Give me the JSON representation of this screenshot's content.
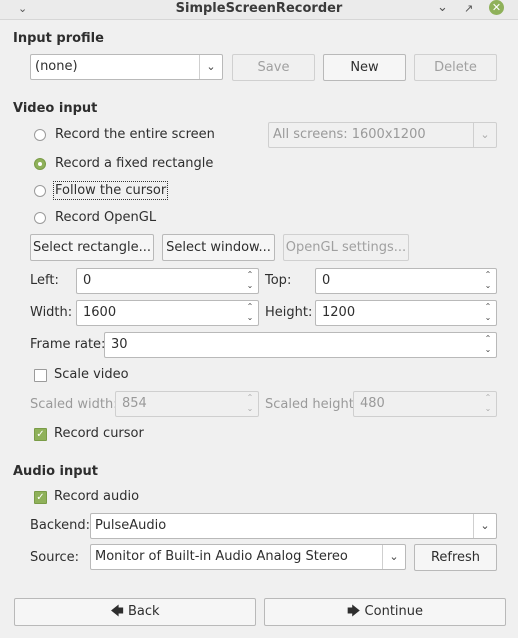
{
  "window": {
    "title": "SimpleScreenRecorder"
  },
  "icons": {
    "minimize": "chevron-down-icon",
    "restore": "restore-icon",
    "close": "close-icon"
  },
  "input_profile": {
    "heading": "Input profile",
    "selected": "(none)",
    "save_label": "Save",
    "new_label": "New",
    "delete_label": "Delete"
  },
  "video_input": {
    "heading": "Video input",
    "radio_entire_screen": "Record the entire screen",
    "radio_fixed_rect": "Record a fixed rectangle",
    "radio_follow_cursor": "Follow the cursor",
    "radio_opengl": "Record OpenGL",
    "selected_mode": "Record a fixed rectangle",
    "screen_select": "All screens: 1600x1200",
    "select_rectangle": "Select rectangle...",
    "select_window": "Select window...",
    "opengl_settings": "OpenGL settings...",
    "left_label": "Left:",
    "left_value": "0",
    "top_label": "Top:",
    "top_value": "0",
    "width_label": "Width:",
    "width_value": "1600",
    "height_label": "Height:",
    "height_value": "1200",
    "framerate_label": "Frame rate:",
    "framerate_value": "30",
    "scale_video_label": "Scale video",
    "scale_video_checked": false,
    "scaled_width_label": "Scaled width:",
    "scaled_width_value": "854",
    "scaled_height_label": "Scaled height:",
    "scaled_height_value": "480",
    "record_cursor_label": "Record cursor",
    "record_cursor_checked": true
  },
  "audio_input": {
    "heading": "Audio input",
    "record_audio_label": "Record audio",
    "record_audio_checked": true,
    "backend_label": "Backend:",
    "backend_value": "PulseAudio",
    "source_label": "Source:",
    "source_value": "Monitor of Built-in Audio Analog Stereo",
    "refresh_label": "Refresh"
  },
  "footer": {
    "back_label": "Back",
    "continue_label": "Continue"
  },
  "colors": {
    "accent": "#8fb15a",
    "background": "#f0f0f0"
  }
}
